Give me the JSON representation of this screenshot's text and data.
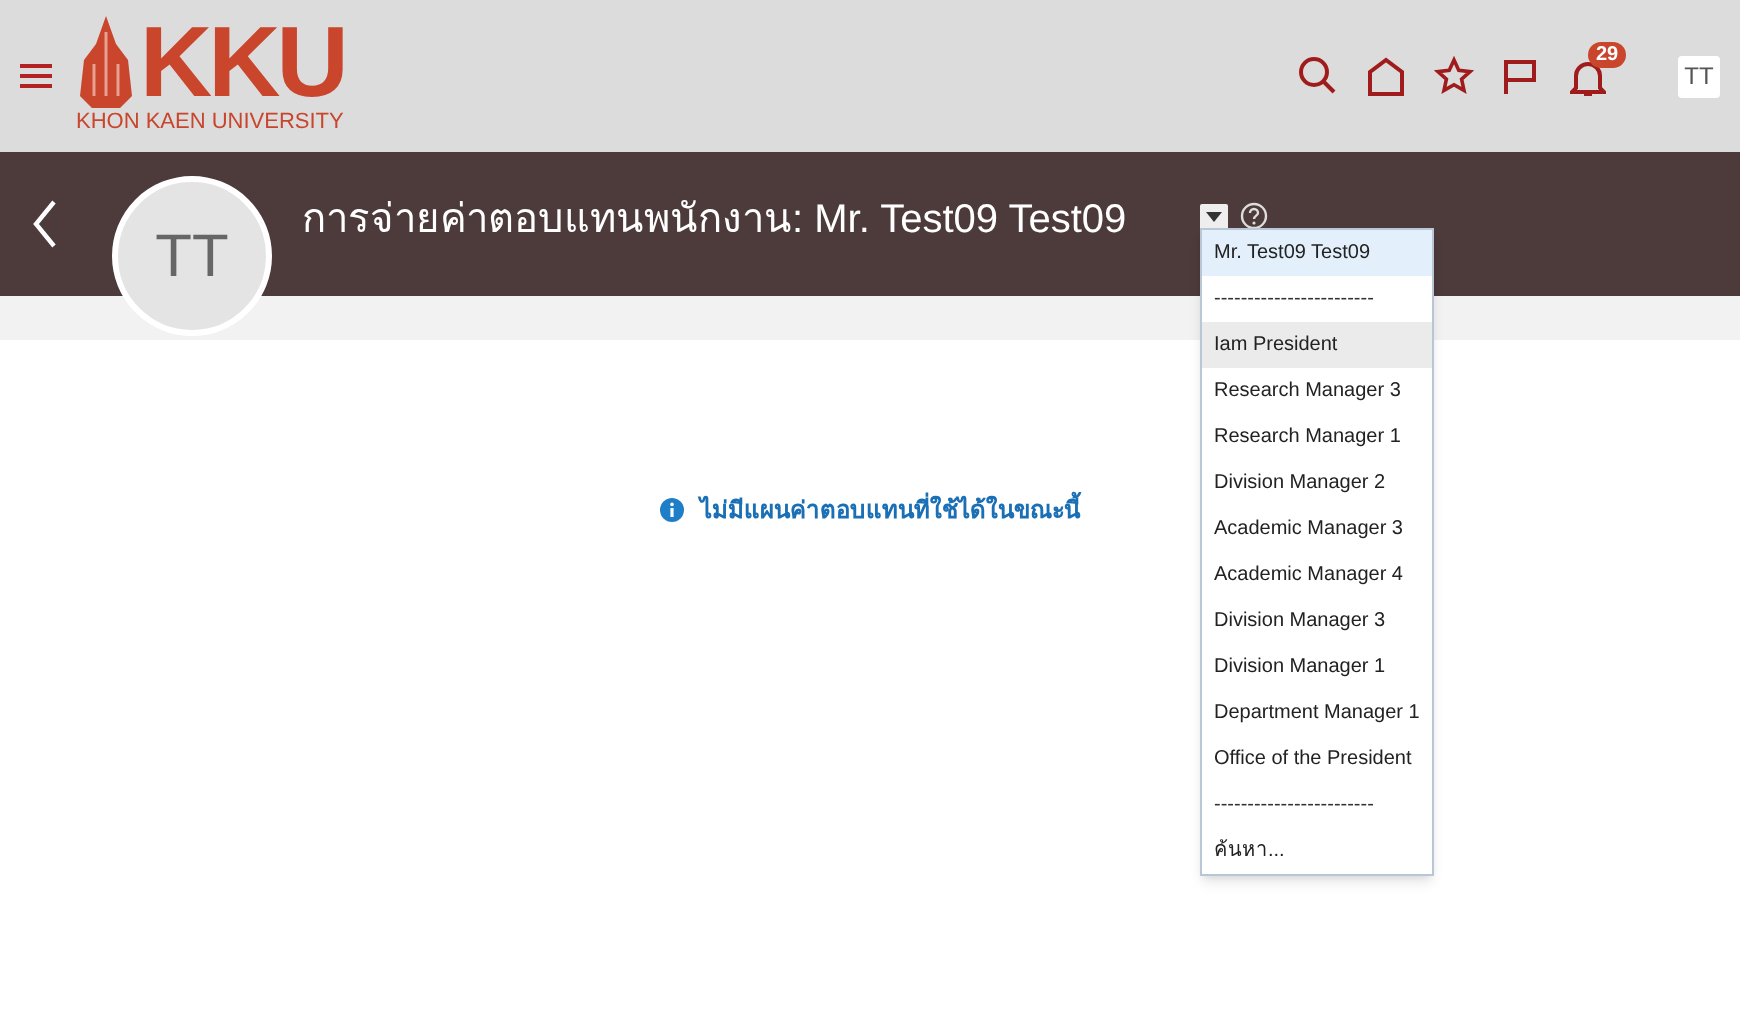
{
  "header": {
    "logo_text": "KKU",
    "logo_subtitle": "KHON KAEN UNIVERSITY",
    "notification_count": "29",
    "user_initials": "TT"
  },
  "banner": {
    "avatar_initials": "TT",
    "title": "การจ่ายค่าตอบแทนพนักงาน: Mr. Test09 Test09"
  },
  "person_menu": {
    "expanded": true,
    "items": [
      {
        "kind": "item",
        "label": "Mr. Test09 Test09",
        "selected": true,
        "highlighted": false
      },
      {
        "kind": "separator",
        "label": "------------------------",
        "selected": false,
        "highlighted": false
      },
      {
        "kind": "item",
        "label": "Iam President",
        "selected": false,
        "highlighted": true
      },
      {
        "kind": "item",
        "label": "Research Manager 3",
        "selected": false,
        "highlighted": false
      },
      {
        "kind": "item",
        "label": "Research Manager 1",
        "selected": false,
        "highlighted": false
      },
      {
        "kind": "item",
        "label": "Division Manager 2",
        "selected": false,
        "highlighted": false
      },
      {
        "kind": "item",
        "label": "Academic Manager 3",
        "selected": false,
        "highlighted": false
      },
      {
        "kind": "item",
        "label": "Academic Manager 4",
        "selected": false,
        "highlighted": false
      },
      {
        "kind": "item",
        "label": "Division Manager 3",
        "selected": false,
        "highlighted": false
      },
      {
        "kind": "item",
        "label": "Division Manager 1",
        "selected": false,
        "highlighted": false
      },
      {
        "kind": "item",
        "label": "Department Manager 1",
        "selected": false,
        "highlighted": false
      },
      {
        "kind": "item",
        "label": "Office of the President",
        "selected": false,
        "highlighted": false
      },
      {
        "kind": "separator",
        "label": "------------------------",
        "selected": false,
        "highlighted": false
      },
      {
        "kind": "item",
        "label": "ค้นหา...",
        "selected": false,
        "highlighted": false
      }
    ]
  },
  "message": "ไม่มีแผนค่าตอบแทนที่ใช้ได้ในขณะนี้"
}
